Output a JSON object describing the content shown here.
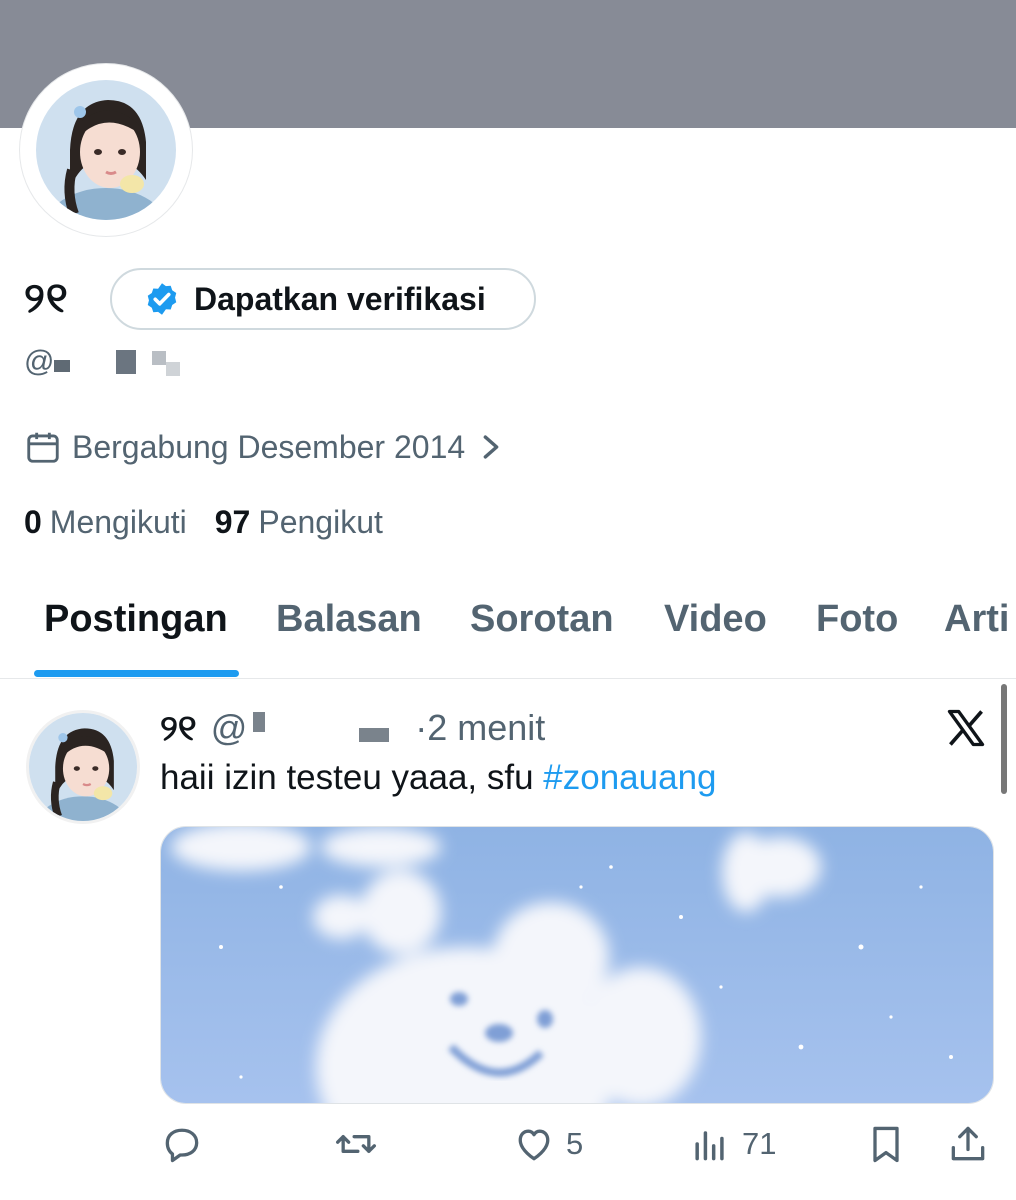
{
  "profile": {
    "display_name": "୨୧",
    "verify_button": "Dapatkan verifikasi",
    "handle_prefix": "@",
    "joined": "Bergabung Desember 2014",
    "following_count": "0",
    "following_label": "Mengikuti",
    "followers_count": "97",
    "followers_label": "Pengikut"
  },
  "tabs": [
    {
      "label": "Postingan",
      "active": true
    },
    {
      "label": "Balasan"
    },
    {
      "label": "Sorotan"
    },
    {
      "label": "Video"
    },
    {
      "label": "Foto"
    },
    {
      "label": "Arti"
    }
  ],
  "post": {
    "name": "୨୧",
    "handle_prefix": "@",
    "time": "·2 menit",
    "text": "haii izin testeu yaaa, sfu ",
    "hashtag": "#zonauang",
    "likes": "5",
    "views": "71"
  },
  "icons": {
    "verify": "verified-badge-icon",
    "joined": "calendar-icon",
    "reply": "reply-icon",
    "retweet": "retweet-icon",
    "like": "heart-icon",
    "views": "views-icon",
    "bookmark": "bookmark-icon",
    "share": "share-icon",
    "brand": "x-logo-icon"
  },
  "colors": {
    "accent": "#1d9bf0",
    "banner": "#878b96",
    "secondary_text": "#536471"
  }
}
